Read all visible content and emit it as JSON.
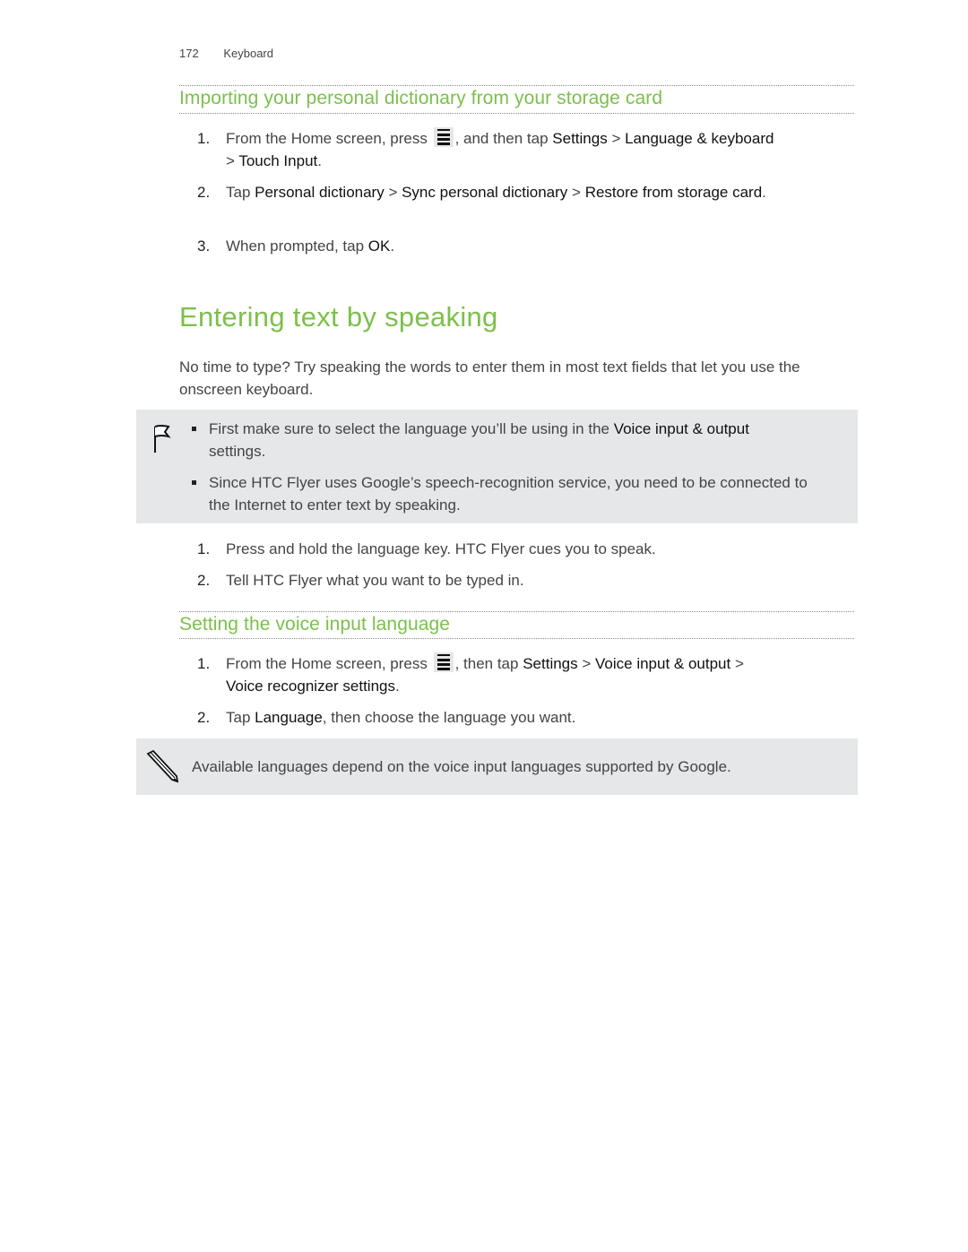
{
  "header": {
    "page_number": "172",
    "chapter": "Keyboard"
  },
  "section1": {
    "title": "Importing your personal dictionary from your storage card",
    "steps": [
      {
        "num": "1.",
        "parts": [
          "From the Home screen, press ",
          ", and then tap ",
          "Settings",
          " > ",
          "Language & keyboard",
          " > ",
          "Touch Input",
          "."
        ]
      },
      {
        "num": "2.",
        "parts": [
          "Tap ",
          "Personal dictionary",
          " > ",
          "Sync personal dictionary",
          " > ",
          "Restore from storage card",
          "."
        ]
      },
      {
        "num": "3.",
        "parts": [
          "When prompted, tap ",
          "OK",
          "."
        ]
      }
    ]
  },
  "main": {
    "title": "Entering text by speaking",
    "intro": "No time to type? Try speaking the words to enter them in most text fields that let you use the onscreen keyboard.",
    "tip": {
      "icon": "flag-icon",
      "bullets": [
        {
          "parts": [
            "First make sure to select the language you’ll be using in the ",
            "Voice input & output",
            " settings."
          ]
        },
        {
          "parts": [
            "Since HTC Flyer uses Google’s speech-recognition service, you need to be connected to the Internet to enter text by speaking."
          ]
        }
      ]
    },
    "steps": [
      {
        "num": "1.",
        "text": "Press and hold the language key. HTC Flyer cues you to speak."
      },
      {
        "num": "2.",
        "text": "Tell HTC Flyer what you want to be typed in."
      }
    ]
  },
  "section2": {
    "title": "Setting the voice input language",
    "steps": [
      {
        "num": "1.",
        "parts": [
          "From the Home screen, press ",
          ", then tap ",
          "Settings",
          " > ",
          "Voice input & output",
          " > ",
          "Voice recognizer settings",
          "."
        ]
      },
      {
        "num": "2.",
        "parts": [
          "Tap ",
          "Language",
          ", then choose the language you want."
        ]
      }
    ],
    "note": {
      "icon": "pencil-icon",
      "text": "Available languages depend on the voice input languages supported by Google."
    }
  },
  "colors": {
    "heading_green": "#7cc04b",
    "note_bg": "#e6e7e8"
  }
}
